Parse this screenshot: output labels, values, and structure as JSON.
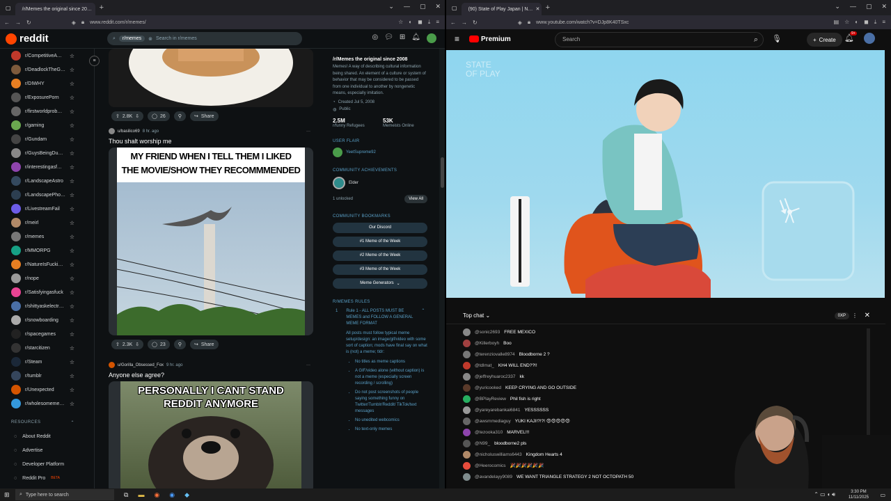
{
  "left_browser": {
    "tab_title": "/r/Memes the original since 20…",
    "url": "www.reddit.com/r/memes/"
  },
  "reddit": {
    "logo_text": "reddit",
    "search_chip": "r/memes",
    "search_placeholder": "Search in r/memes",
    "sidebar": [
      {
        "label": "r/CompetitiveA…",
        "color": "#c0392b"
      },
      {
        "label": "r/DeadlockTheG…",
        "color": "#7d5a3c"
      },
      {
        "label": "r/DIWHY",
        "color": "#e67e22"
      },
      {
        "label": "r/ExposurePorn",
        "color": "#555"
      },
      {
        "label": "r/firstworldprob…",
        "color": "#666"
      },
      {
        "label": "r/gaming",
        "color": "#6aa84f"
      },
      {
        "label": "r/Gundam",
        "color": "#444"
      },
      {
        "label": "r/GuysBeingDu…",
        "color": "#888"
      },
      {
        "label": "r/interestingasf…",
        "color": "#8e44ad"
      },
      {
        "label": "r/LandscapeAstro",
        "color": "#34495e"
      },
      {
        "label": "r/LandscapePho…",
        "color": "#2c3e50"
      },
      {
        "label": "r/LivestreamFail",
        "color": "#6c5ce7"
      },
      {
        "label": "r/meirl",
        "color": "#b08968"
      },
      {
        "label": "r/memes",
        "color": "#777"
      },
      {
        "label": "r/MMORPG",
        "color": "#16a085"
      },
      {
        "label": "r/NatureIsFucki…",
        "color": "#e67e22"
      },
      {
        "label": "r/nope",
        "color": "#999"
      },
      {
        "label": "r/Satisfyingasfuck",
        "color": "#e84393"
      },
      {
        "label": "r/shittyaskelectr…",
        "color": "#4a6fa5"
      },
      {
        "label": "r/snowboarding",
        "color": "#aaa"
      },
      {
        "label": "r/spacegames",
        "color": "#222"
      },
      {
        "label": "r/starcitizen",
        "color": "#333"
      },
      {
        "label": "r/Steam",
        "color": "#1b2838"
      },
      {
        "label": "r/tumblr",
        "color": "#35465c"
      },
      {
        "label": "r/Unexpected",
        "color": "#d35400"
      },
      {
        "label": "r/wholesomeme…",
        "color": "#3498db"
      }
    ],
    "resources_header": "RESOURCES",
    "resources": [
      {
        "label": "About Reddit",
        "icon": "reddit-icon"
      },
      {
        "label": "Advertise",
        "icon": "megaphone-icon"
      },
      {
        "label": "Developer Platform",
        "icon": "code-icon"
      },
      {
        "label": "Reddit Pro",
        "icon": "chart-icon",
        "badge": "BETA"
      }
    ],
    "posts": [
      {
        "votes": "2.8K",
        "comments": "26",
        "share": "Share"
      },
      {
        "author": "u/basilico69",
        "ago": "8 hr. ago",
        "title": "Thou shalt worship me",
        "meme_text": "MY FRIEND WHEN I TELL THEM I LIKED THE MOVIE/SHOW THEY RECOMMMENDED",
        "votes": "2.3K",
        "comments": "23",
        "share": "Share"
      },
      {
        "author": "u/Gorilla_Obsessed_Fox",
        "ago": "9 hr. ago",
        "title": "Anyone else agree?",
        "meme_text": "PERSONALLY I CANT STAND REDDIT ANYMORE"
      }
    ],
    "panel": {
      "title": "/r/Memes the original since 2008",
      "description": "Memes! A way of describing cultural information being shared. An element of a culture or system of behavior that may be considered to be passed from one individual to another by nongenetic means, especially imitation.",
      "created": "Created Jul 5, 2008",
      "visibility": "Public",
      "members": "2.5M",
      "members_label": "r/funny Refugees",
      "online": "53K",
      "online_label": "Memeists Online",
      "user_flair_header": "USER FLAIR",
      "user_flair": "YeetSupreme92",
      "achievements_header": "COMMUNITY ACHIEVEMENTS",
      "achievement": "Elder",
      "unlocked": "1 unlocked",
      "view_all": "View All",
      "bookmarks_header": "COMMUNITY BOOKMARKS",
      "bookmarks": [
        "Our Discord",
        "#1 Meme of the Week",
        "#2 Meme of the Week",
        "#3 Meme of the Week",
        "Meme Generators"
      ],
      "rules_header": "R/MEMES RULES",
      "rule_num": "1",
      "rule_title": "Rule 1 - ALL POSTS MUST BE MEMES and FOLLOW A GENERAL MEME FORMAT",
      "rule_body": "All posts must follow typical meme setup/design: an image/gif/video with some sort of caption; mods have final say on what is (not) a meme; tldr:",
      "rule_bullets": [
        "No titles as meme captions",
        "A GIF/video alone (without caption) is not a meme (especially screen recording / scrolling)",
        "Do not post screenshots of people saying something funny on Twitter/Tumblr/Reddit/ TikTok/text messages",
        "No unedited webcomics",
        "No text-only memes"
      ]
    }
  },
  "right_browser": {
    "tab_title": "(90) State of Play Japan | N…",
    "url": "www.youtube.com/watch?v=DJp8K40TSxc"
  },
  "youtube": {
    "logo_text": "Premium",
    "search_placeholder": "Search",
    "create_label": "Create",
    "notif_count": "9+",
    "chat": {
      "mode": "Top chat",
      "points": "0XP",
      "messages": [
        {
          "author": "@sonic2693",
          "text": "FREE MEXICO",
          "color": "#888"
        },
        {
          "author": "@Killerboyh",
          "text": "Boo",
          "color": "#a04040"
        },
        {
          "author": "@terenziovalle8974",
          "text": "Bloodborne 2 ?",
          "color": "#777"
        },
        {
          "author": "@tdlmat_",
          "text": "KH4 WILL END??!!",
          "color": "#c0392b"
        },
        {
          "author": "@jeffreyhuaroc2337",
          "text": "kk",
          "color": "#888"
        },
        {
          "author": "@yuricooked",
          "text": "KEEP CRYING AND GO OUTSIDE",
          "color": "#5a3a2a"
        },
        {
          "author": "@BPlayReview",
          "text": "Phil fish is right",
          "color": "#27ae60"
        },
        {
          "author": "@yareyarebankai6841",
          "text": "YESSSSSS",
          "color": "#999"
        },
        {
          "author": "@awsmmediaguy",
          "text": "YUKI KAJI!?!?! 😍😍😍😍😍",
          "color": "#666"
        },
        {
          "author": "@tezooka310",
          "text": "MARVEL!!!",
          "color": "#8e44ad"
        },
        {
          "author": "@N99_",
          "text": "bloodborne2 pls",
          "color": "#555"
        },
        {
          "author": "@nicholuswilliams6443",
          "text": "Kingdom Hearts 4",
          "color": "#b08968"
        },
        {
          "author": "@Heerocomics",
          "text": "🎉🎉🎉🎉🎉🎉",
          "color": "#e74c3c"
        },
        {
          "author": "@avandelayy9089",
          "text": "WE WANT TRIANGLE STRATEGY 2 NOT OCTOPATH 50",
          "color": "#7f8c8d"
        }
      ]
    }
  },
  "taskbar": {
    "search_placeholder": "Type here to search",
    "time": "3:30 PM",
    "date": "11/11/2025"
  }
}
